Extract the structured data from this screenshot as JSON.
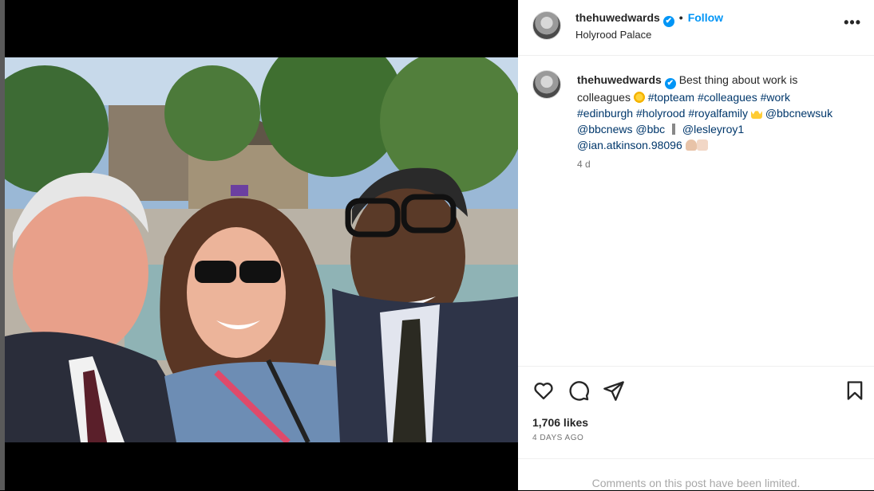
{
  "post": {
    "username": "thehuwedwards",
    "verified_mark": "✔",
    "separator": "•",
    "follow_label": "Follow",
    "location": "Holyrood Palace",
    "more_label": "•••",
    "caption": {
      "text_1": "Best thing about work is colleagues",
      "tags_1": "#topteam #colleagues #work #edinburgh #holyrood #royalfamily",
      "mentions_1": "@bbcnewsuk @bbcnews @bbc",
      "mentions_2": "@lesleyroy1 @ian.atkinson.98096"
    },
    "time_ago": "4 d",
    "likes": "1,706 likes",
    "date": "4 DAYS AGO",
    "comments_notice": "Comments on this post have been limited."
  },
  "icons": {
    "like": "heart-icon",
    "comment": "comment-icon",
    "share": "send-icon",
    "save": "bookmark-icon",
    "more": "more-options-icon"
  },
  "colors": {
    "accent": "#0095f6",
    "link": "#00376b",
    "muted": "#737373"
  }
}
